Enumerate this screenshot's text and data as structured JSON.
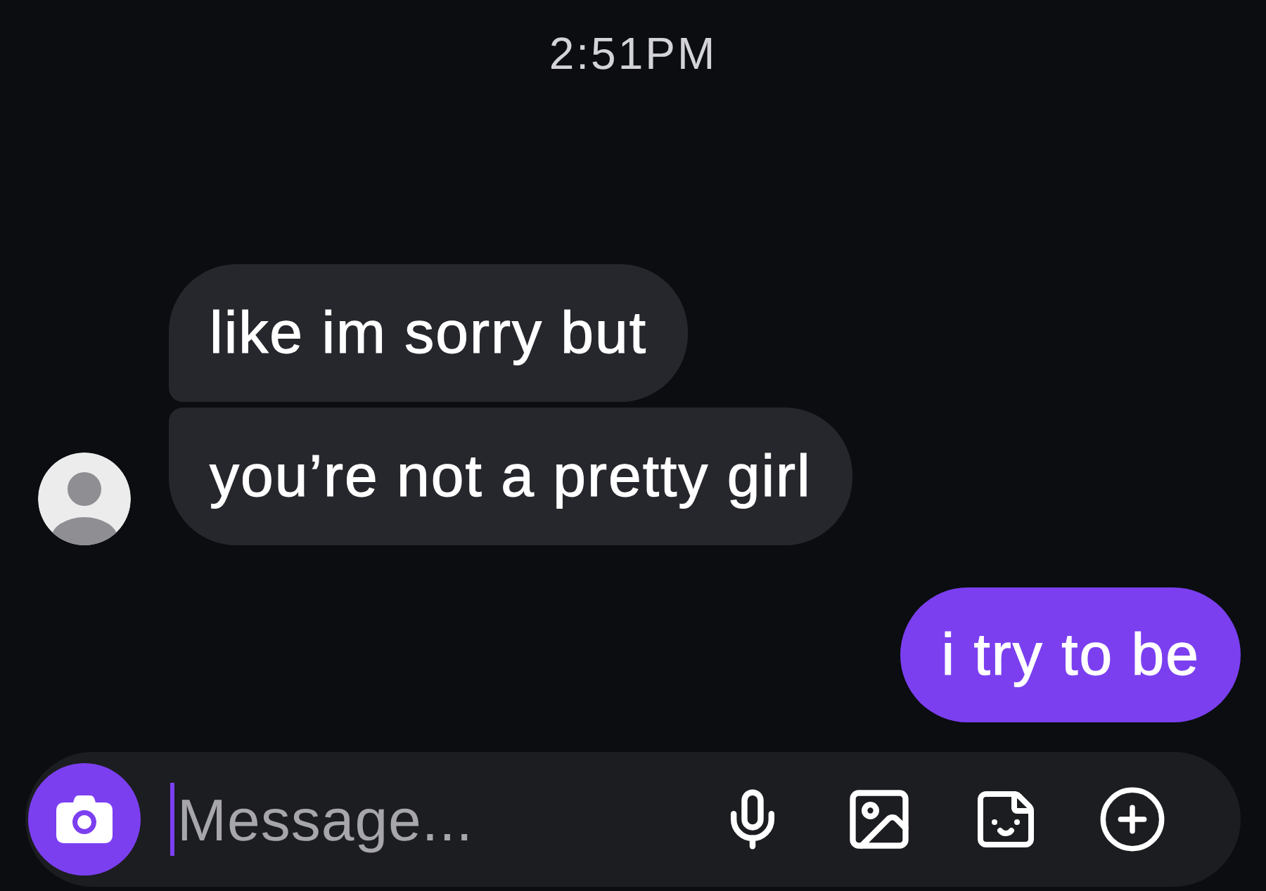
{
  "time": "2:51PM",
  "message_groups": [
    {
      "kind": "received",
      "messages": [
        "like im sorry but",
        "you’re not a pretty girl"
      ]
    },
    {
      "kind": "sent",
      "messages": [
        "i try to be"
      ]
    }
  ],
  "composer": {
    "placeholder": "Message..."
  }
}
